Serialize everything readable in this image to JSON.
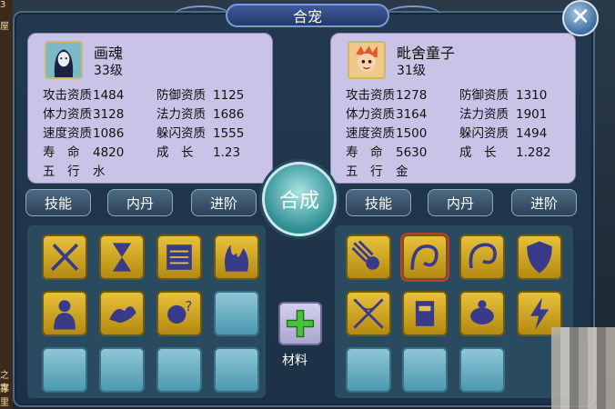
{
  "title": "合宠",
  "merge_label": "合成",
  "material_label": "材料",
  "tabs": {
    "skill": "技能",
    "neidan": "内丹",
    "advance": "进阶"
  },
  "left_pet": {
    "name": "画魂",
    "level": "33级",
    "stats": [
      [
        "攻击资质",
        "1484",
        "防御资质",
        "1125"
      ],
      [
        "体力资质",
        "3128",
        "法力资质",
        "1686"
      ],
      [
        "速度资质",
        "1086",
        "躲闪资质",
        "1555"
      ],
      [
        "寿　命",
        "4820",
        "成　长",
        "1.23"
      ],
      [
        "五　行",
        "水",
        "",
        ""
      ]
    ]
  },
  "right_pet": {
    "name": "毗舍童子",
    "level": "31级",
    "stats": [
      [
        "攻击资质",
        "1278",
        "防御资质",
        "1310"
      ],
      [
        "体力资质",
        "3164",
        "法力资质",
        "1901"
      ],
      [
        "速度资质",
        "1500",
        "躲闪资质",
        "1494"
      ],
      [
        "寿　命",
        "5630",
        "成　长",
        "1.282"
      ],
      [
        "五　行",
        "金",
        "",
        ""
      ]
    ]
  },
  "left_skills": [
    "swords-icon",
    "hourglass-icon",
    "tablet-icon",
    "flames-icon",
    "silhouette-icon",
    "spirit-icon",
    "mystery-hand-icon",
    "empty",
    "empty",
    "empty",
    "empty",
    "empty"
  ],
  "right_skills": [
    "meteor-icon",
    "spiral-icon",
    "recurve-icon",
    "shield-icon",
    "crossed-blades-icon",
    "armor-icon",
    "turtle-icon",
    "lightning-icon",
    "empty",
    "empty",
    "empty",
    "empty"
  ],
  "side_text": [
    "3",
    "屋",
    "之存",
    "宝",
    "里"
  ]
}
